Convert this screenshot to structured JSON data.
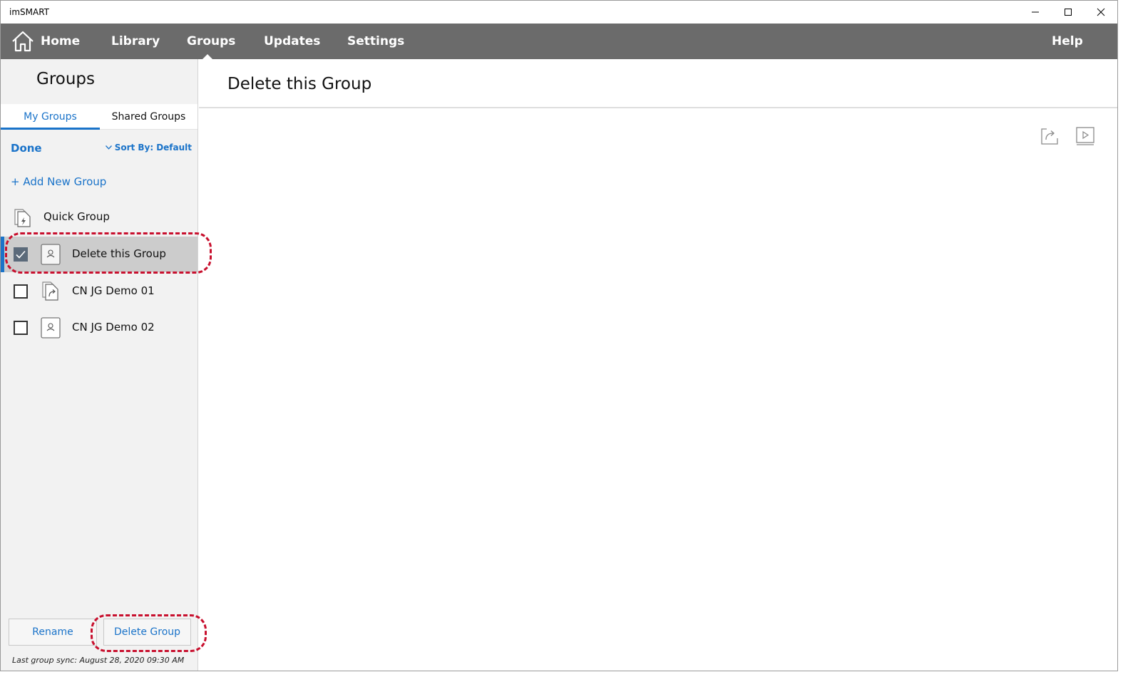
{
  "window": {
    "title": "imSMART"
  },
  "nav": {
    "home_icon": "home-icon",
    "items": [
      "Home",
      "Library",
      "Groups",
      "Updates",
      "Settings"
    ],
    "active": "Groups",
    "help": "Help"
  },
  "sidebar": {
    "title": "Groups",
    "tabs": [
      "My Groups",
      "Shared Groups"
    ],
    "active_tab": "My Groups",
    "done_label": "Done",
    "sort_label": "Sort By:",
    "sort_value": "Default",
    "add_group_label": "+ Add New Group",
    "quick_group": {
      "label": "Quick Group",
      "icon": "quick-group-icon"
    },
    "groups": [
      {
        "label": "Delete this Group",
        "checked": true,
        "selected": true,
        "icon": "person-icon"
      },
      {
        "label": "CN JG Demo 01",
        "checked": false,
        "selected": false,
        "icon": "shared-document-icon"
      },
      {
        "label": "CN JG Demo 02",
        "checked": false,
        "selected": false,
        "icon": "person-icon"
      }
    ],
    "rename_label": "Rename",
    "delete_label": "Delete Group",
    "sync_text": "Last group sync: August 28, 2020 09:30 AM"
  },
  "main": {
    "title": "Delete this Group",
    "tools": [
      "share-icon",
      "present-icon"
    ]
  },
  "colors": {
    "accent": "#1a73c9",
    "nav_bg": "#6b6b6b",
    "annotation": "#c8102e",
    "selected_row": "#cccccc"
  }
}
